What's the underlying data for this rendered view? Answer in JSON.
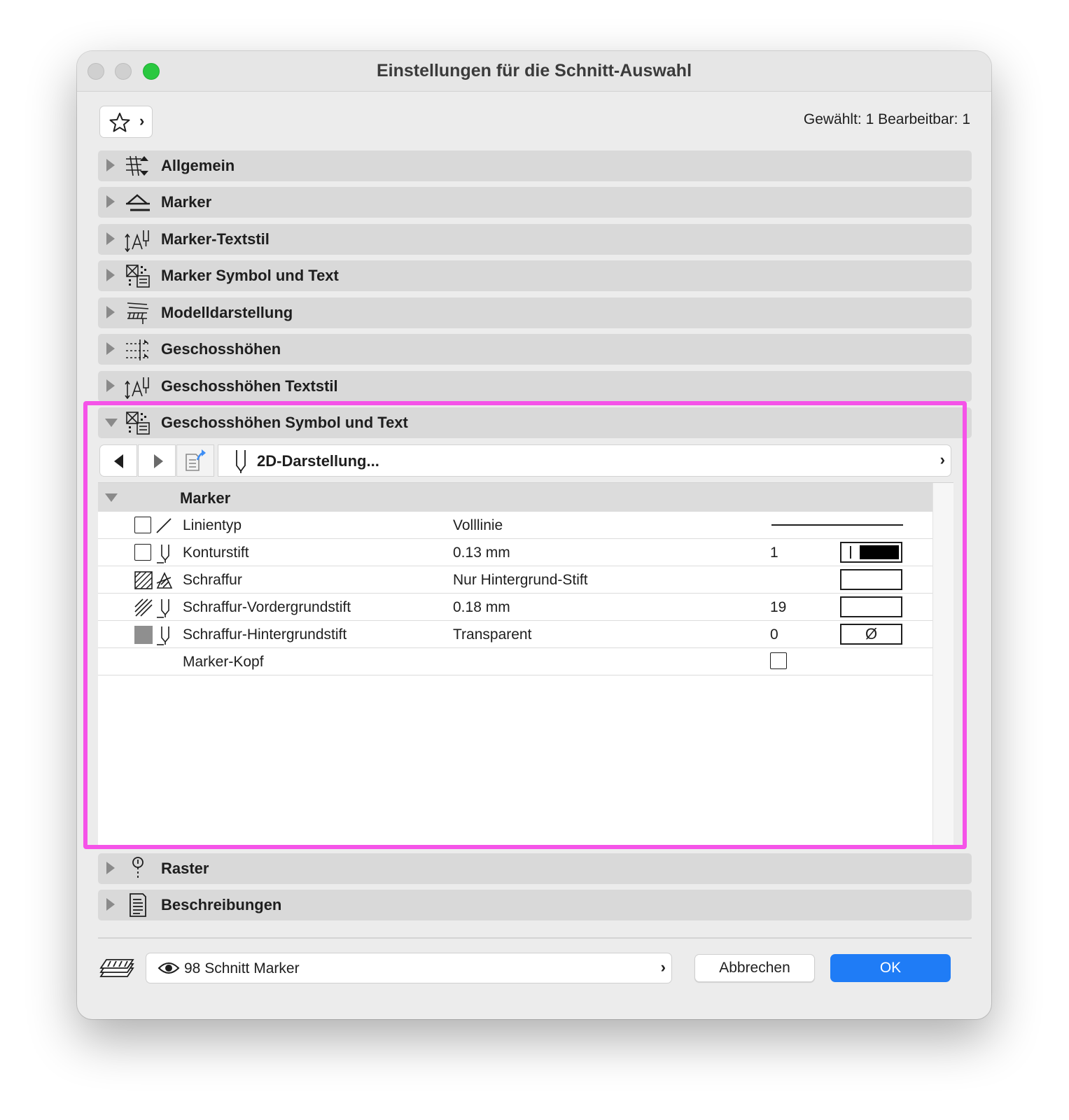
{
  "window": {
    "title": "Einstellungen für die Schnitt-Auswahl"
  },
  "header": {
    "selection_info": "Gewählt: 1 Bearbeitbar: 1"
  },
  "sections": [
    {
      "label": "Allgemein",
      "icon": "general-settings-icon"
    },
    {
      "label": "Marker",
      "icon": "marker-icon"
    },
    {
      "label": "Marker-Textstil",
      "icon": "text-style-icon"
    },
    {
      "label": "Marker Symbol und Text",
      "icon": "symbol-text-icon"
    },
    {
      "label": "Modelldarstellung",
      "icon": "model-display-icon"
    },
    {
      "label": "Geschosshöhen",
      "icon": "story-levels-icon"
    },
    {
      "label": "Geschosshöhen Textstil",
      "icon": "text-style-icon"
    },
    {
      "label": "Geschosshöhen Symbol und Text",
      "icon": "symbol-text-icon",
      "expanded": true
    },
    {
      "label": "Raster",
      "icon": "grid-icon"
    },
    {
      "label": "Beschreibungen",
      "icon": "descriptions-icon"
    }
  ],
  "panel": {
    "tab_label": "2D-Darstellung...",
    "group_label": "Marker",
    "rows": [
      {
        "name": "Linientyp",
        "value": "Volllinie",
        "number": ""
      },
      {
        "name": "Konturstift",
        "value": "0.13 mm",
        "number": "1"
      },
      {
        "name": "Schraffur",
        "value": "Nur Hintergrund-Stift",
        "number": ""
      },
      {
        "name": "Schraffur-Vordergrundstift",
        "value": "0.18 mm",
        "number": "19"
      },
      {
        "name": "Schraffur-Hintergrundstift",
        "value": "Transparent",
        "number": "0"
      },
      {
        "name": "Marker-Kopf",
        "value": "",
        "number": ""
      }
    ],
    "transparent_symbol": "Ø"
  },
  "footer": {
    "layer": "98 Schnitt Marker",
    "cancel_label": "Abbrechen",
    "ok_label": "OK"
  },
  "colors": {
    "accent": "#1f7cf6",
    "highlight": "#f553e8",
    "traffic_light_green": "#2ac840"
  }
}
